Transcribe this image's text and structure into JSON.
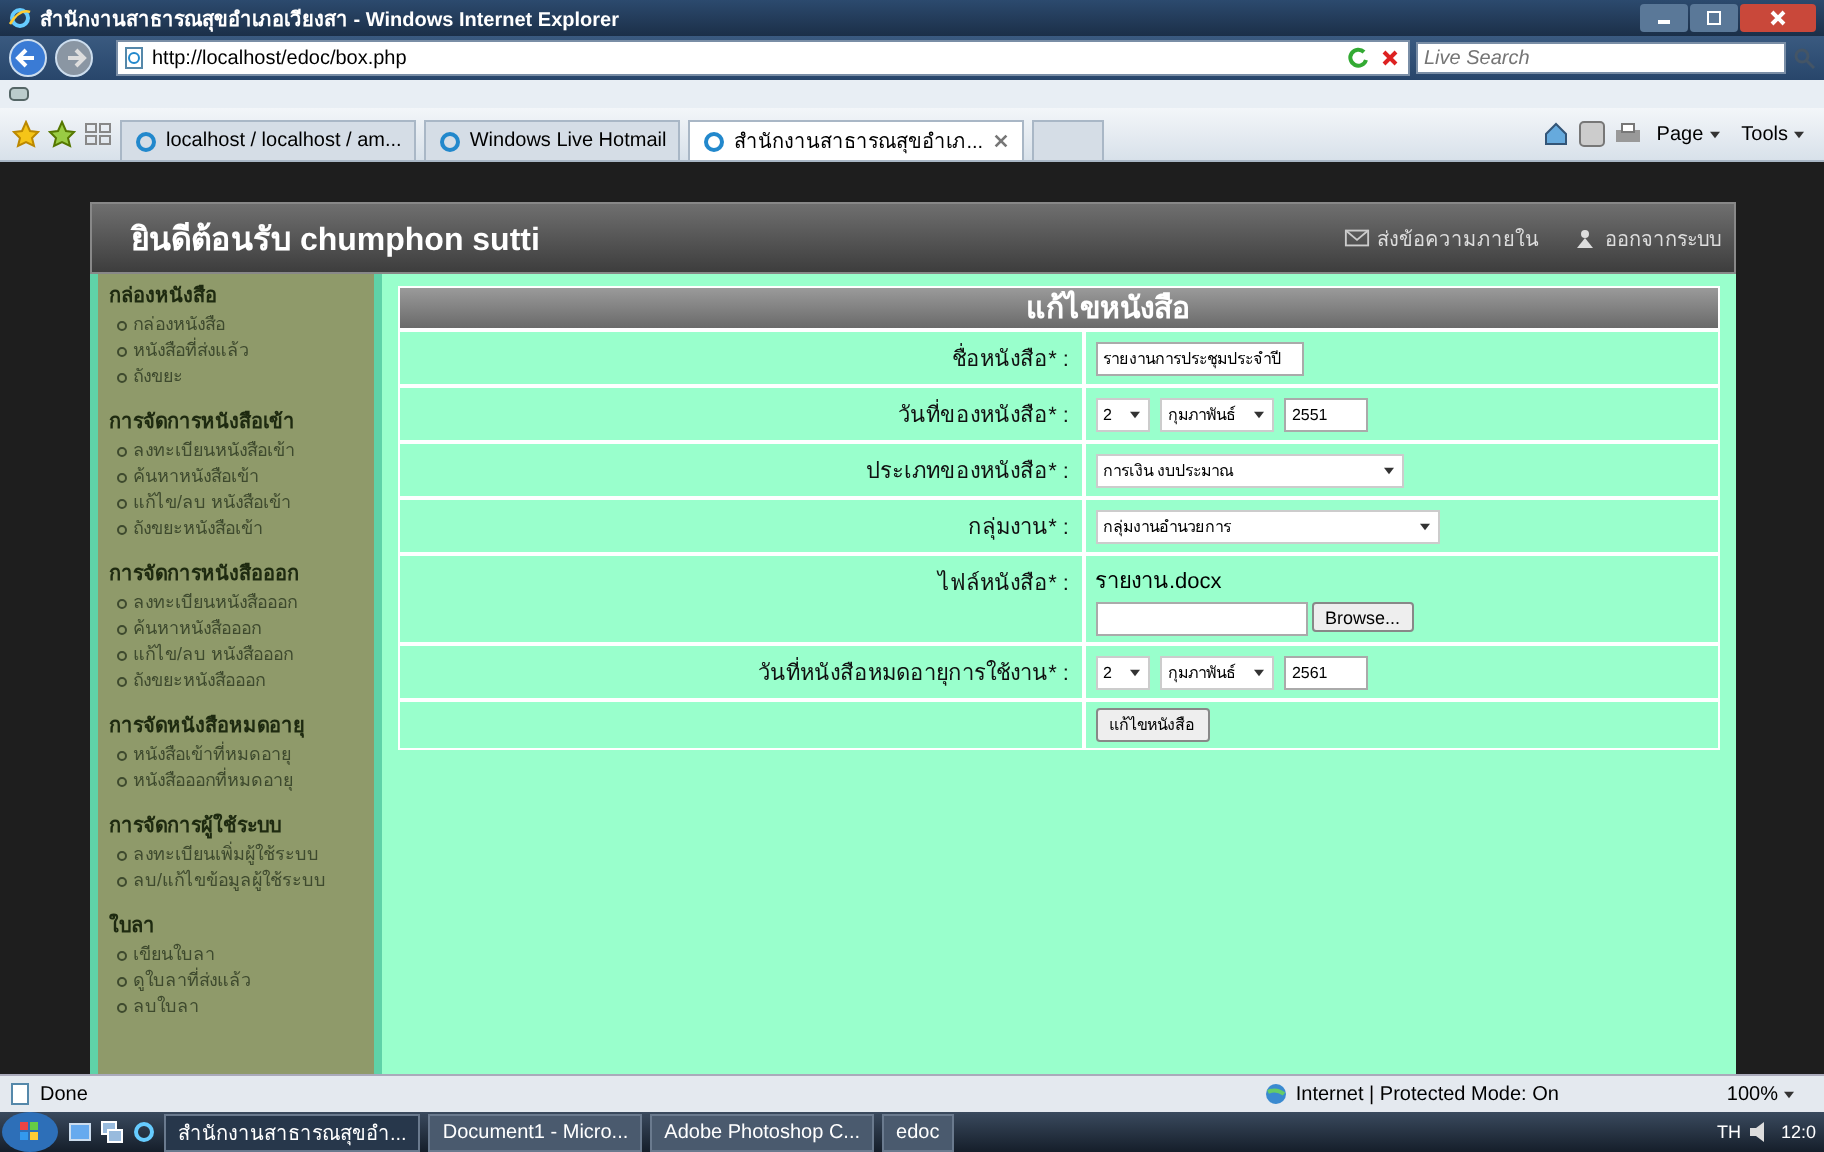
{
  "browser": {
    "title": "สำนักงานสาธารณสุขอำเภอเวียงสา - Windows Internet Explorer",
    "address": "http://localhost/edoc/box.php",
    "search": {
      "placeholder": "Live Search"
    },
    "tabs": [
      {
        "label": "localhost / localhost / am...",
        "selected": false
      },
      {
        "label": "Windows Live Hotmail",
        "selected": false
      },
      {
        "label": "สำนักงานสาธารณสุขอำเภ...",
        "selected": true
      }
    ],
    "command_buttons": [
      "Page",
      "Tools"
    ],
    "status_bar": {
      "text": "Done",
      "zone": "Internet | Protected Mode: On",
      "zoom": "100%"
    }
  },
  "page": {
    "welcome": "ยินดีต้อนรับ chumphon sutti",
    "header_links": [
      {
        "label": "ส่งข้อความภายใน",
        "kind": "mail"
      },
      {
        "label": "ออกจากระบบ",
        "kind": "logout"
      }
    ],
    "sidebar": [
      {
        "title": "กล่องหนังสือ",
        "items": [
          "กล่องหนังสือ",
          "หนังสือที่ส่งแล้ว",
          "ถังขยะ"
        ]
      },
      {
        "title": "การจัดการหนังสือเข้า",
        "items": [
          "ลงทะเบียนหนังสือเข้า",
          "ค้นหาหนังสือเข้า",
          "แก้ไข/ลบ หนังสือเข้า",
          "ถังขยะหนังสือเข้า"
        ]
      },
      {
        "title": "การจัดการหนังสือออก",
        "items": [
          "ลงทะเบียนหนังสือออก",
          "ค้นหาหนังสือออก",
          "แก้ไข/ลบ หนังสือออก",
          "ถังขยะหนังสือออก"
        ]
      },
      {
        "title": "การจัดหนังสือหมดอายุ",
        "items": [
          "หนังสือเข้าที่หมดอายุ",
          "หนังสือออกที่หมดอายุ"
        ]
      },
      {
        "title": "การจัดการผู้ใช้ระบบ",
        "items": [
          "ลงทะเบียนเพิ่มผู้ใช้ระบบ",
          "ลบ/แก้ไขข้อมูลผู้ใช้ระบบ"
        ]
      },
      {
        "title": "ใบลา",
        "items": [
          "เขียนใบลา",
          "ดูใบลาที่ส่งแล้ว",
          "ลบใบลา"
        ]
      }
    ],
    "form": {
      "title": "แก้ไขหนังสือ",
      "fields": [
        {
          "kind": "text",
          "label": "ชื่อหนังสือ* :",
          "value": "รายงานการประชุมประจำปี"
        },
        {
          "kind": "date",
          "label": "วันที่ของหนังสือ* :",
          "day": "2",
          "month": "กุมภาพันธ์",
          "year": "2551"
        },
        {
          "kind": "select",
          "label": "ประเภทของหนังสือ* :",
          "value": "การเงิน งบประมาณ"
        },
        {
          "kind": "select",
          "label": "กลุ่มงาน* :",
          "value": "กลุ่มงานอำนวยการ"
        },
        {
          "kind": "file",
          "label": "ไฟล์หนังสือ* :",
          "current": "รายงาน.docx",
          "browse": "Browse..."
        },
        {
          "kind": "date",
          "label": "วันที่หนังสือหมดอายุการใช้งาน* :",
          "day": "2",
          "month": "กุมภาพันธ์",
          "year": "2561"
        }
      ],
      "submit": "แก้ไขหนังสือ"
    }
  },
  "taskbar": {
    "items": [
      {
        "label": "สำนักงานสาธารณสุขอำ...",
        "selected": true
      },
      {
        "label": "Document1 - Micro...",
        "selected": false
      },
      {
        "label": "Adobe Photoshop C...",
        "selected": false
      },
      {
        "label": "edoc",
        "selected": false
      }
    ],
    "language": "TH",
    "clock": "12:0"
  }
}
